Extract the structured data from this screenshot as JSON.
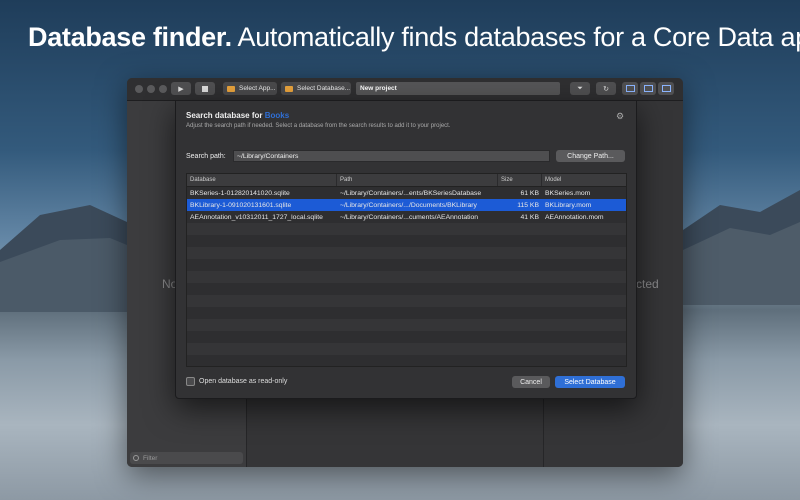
{
  "headline": {
    "bold": "Database finder.",
    "rest": " Automatically finds databases for a Core Data app."
  },
  "toolbar": {
    "select_app": "Select App...",
    "select_database": "Select Database...",
    "project_name": "New project"
  },
  "background_panes": {
    "left_text": "No",
    "right_text": "cted"
  },
  "sidebar": {
    "filter_placeholder": "Filter"
  },
  "sheet": {
    "title_prefix": "Search database for ",
    "title_app": "Books",
    "subtitle": "Adjust the search path if needed. Select a database from the search results to add it to your project.",
    "search_path_label": "Search path:",
    "search_path_value": "~/Library/Containers",
    "change_path_button": "Change Path...",
    "columns": [
      "Database",
      "Path",
      "Size",
      "Model"
    ],
    "rows": [
      {
        "database": "BKSeries-1-012820141020.sqlite",
        "path": "~/Library/Containers/...ents/BKSeriesDatabase",
        "size": "61 KB",
        "model": "BKSeries.mom",
        "selected": false
      },
      {
        "database": "BKLibrary-1-091020131601.sqlite",
        "path": "~/Library/Containers/.../Documents/BKLibrary",
        "size": "115 KB",
        "model": "BKLibrary.mom",
        "selected": true
      },
      {
        "database": "AEAnnotation_v10312011_1727_local.sqlite",
        "path": "~/Library/Containers/...cuments/AEAnnotation",
        "size": "41 KB",
        "model": "AEAnnotation.mom",
        "selected": false
      }
    ],
    "readonly_label": "Open database as read-only",
    "readonly_checked": false,
    "cancel_button": "Cancel",
    "select_button": "Select Database"
  },
  "colors": {
    "accent": "#2f6fd6",
    "selection": "#1c5bd6"
  }
}
